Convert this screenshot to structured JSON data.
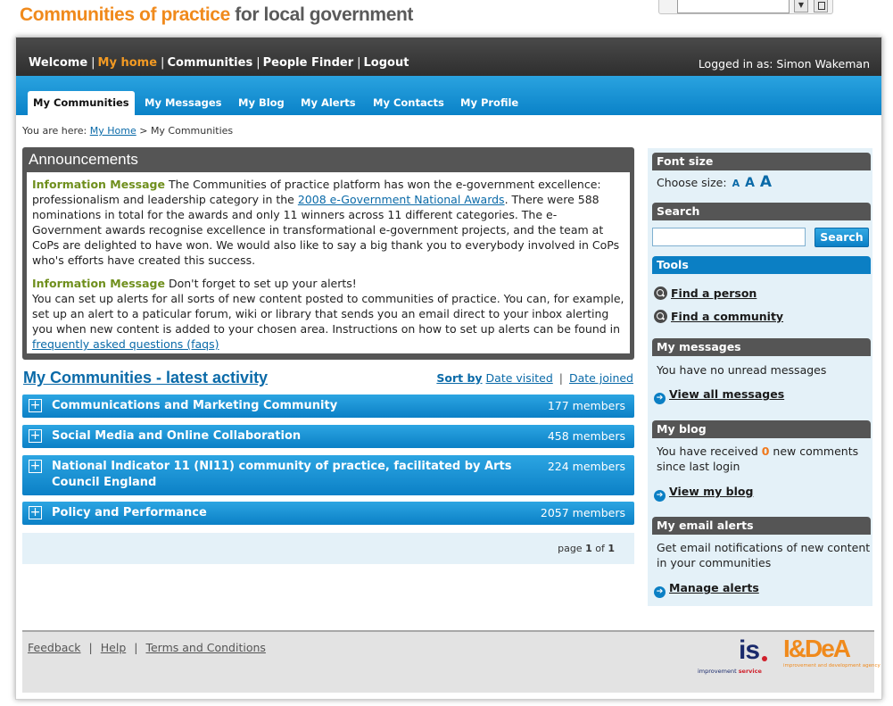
{
  "site": {
    "logo_part1": "Communities of practice",
    "logo_part2": " for local government"
  },
  "browser": {
    "dropdown_arrow": "▼"
  },
  "topnav": {
    "items": [
      {
        "label": "Welcome",
        "active": false
      },
      {
        "label": "My home",
        "active": true
      },
      {
        "label": "Communities",
        "active": false
      },
      {
        "label": "People Finder",
        "active": false
      },
      {
        "label": "Logout",
        "active": false
      }
    ],
    "separator": "|",
    "logged_in": "Logged in as: Simon Wakeman",
    "active_color": "#f39a23"
  },
  "tabs": [
    {
      "label": "My Communities",
      "active": true
    },
    {
      "label": "My Messages",
      "active": false
    },
    {
      "label": "My Blog",
      "active": false
    },
    {
      "label": "My Alerts",
      "active": false
    },
    {
      "label": "My Contacts",
      "active": false
    },
    {
      "label": "My Profile",
      "active": false
    }
  ],
  "breadcrumb": {
    "prefix": "You are here: ",
    "home": "My Home",
    "separator": " > ",
    "current": "My Communities"
  },
  "announcements": {
    "title": "Announcements",
    "messages": [
      {
        "label": "Information Message",
        "text_before": " The Communities of practice platform has won the e-government excellence: professionalism and leadership category in the ",
        "link": "2008 e-Government National Awards",
        "text_after": ". There were 588 nominations in total for the awards and only 11 winners across 11 different categories. The e-Government awards recognise excellence in transformational e-government projects, and the team at CoPs are delighted to have won. We would also like to say a big thank you to everybody involved in CoPs who's efforts have created this success."
      },
      {
        "label": "Information Message",
        "text_before": " Don't forget to set up your alerts!",
        "text_body": "You can set up alerts for all sorts of new content posted to communities of practice. You can, for example, set up an alert to a paticular forum, wiki or library that sends you an email direct to your inbox alerting you when new content is added to your chosen area. Instructions on how to set up alerts can be found in ",
        "link": "frequently asked questions (faqs)"
      }
    ]
  },
  "activity": {
    "title": "My Communities - latest activity",
    "sort_label": "Sort by",
    "sort_options": [
      "Date visited",
      "Date joined"
    ],
    "sort_separator": "|",
    "expand_symbol": "+",
    "communities": [
      {
        "name": "Communications and Marketing Community",
        "members": "177 members"
      },
      {
        "name": "Social Media and Online Collaboration",
        "members": "458 members"
      },
      {
        "name": "National Indicator 11 (NI11) community of practice, facilitated by Arts Council England",
        "members": "224 members"
      },
      {
        "name": "Policy and Performance",
        "members": "2057 members"
      }
    ],
    "pager": {
      "prefix": "page ",
      "current": "1",
      "of": " of ",
      "total": "1"
    }
  },
  "sidebar": {
    "font_size": {
      "title": "Font size",
      "label": "Choose size:",
      "sizes": [
        "A",
        "A",
        "A"
      ]
    },
    "search": {
      "title": "Search",
      "button": "Search",
      "value": ""
    },
    "tools": {
      "title": "Tools",
      "links": [
        {
          "label": "Find a person",
          "icon": "magnifier-icon"
        },
        {
          "label": "Find a community",
          "icon": "magnifier-icon"
        }
      ]
    },
    "messages": {
      "title": "My messages",
      "text": "You have no unread messages",
      "link": "View all messages"
    },
    "blog": {
      "title": "My blog",
      "text_before": "You have received ",
      "count": "0",
      "text_after": " new comments",
      "text_line2": "since last login",
      "link": "View my blog"
    },
    "email_alerts": {
      "title": "My email alerts",
      "text_line1": "Get email notifications of new content",
      "text_line2": "in your communities",
      "link": "Manage alerts"
    },
    "arrow_glyph": "➔"
  },
  "footer": {
    "links": [
      "Feedback",
      "Help",
      "Terms and Conditions"
    ],
    "separator": "|",
    "logo_is": {
      "mark": "is",
      "tag_before": "improvement ",
      "tag_highlight": "service"
    },
    "logo_idea": {
      "mark": "I&DeA",
      "tag": "improvement and development agency"
    }
  },
  "colors": {
    "orange": "#f08a1c",
    "blue": "#0b7fc4",
    "dark_bar": "#3a3a3a",
    "sidebar_bg": "#e4f1f8",
    "info_label": "#6f8f1d"
  }
}
